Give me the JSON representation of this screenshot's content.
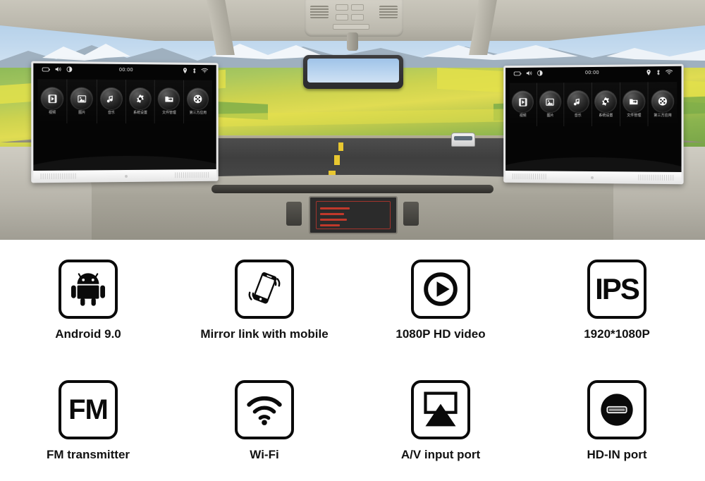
{
  "scene": {
    "name": "car-interior-with-headrest-monitors",
    "description": "Rear view of car cabin driving on a mountain road with two Android headrest monitors mounted on the front seat headrests"
  },
  "monitors": [
    {
      "id": "left",
      "status_bar": {
        "clock": "00:00",
        "left_icons": [
          "battery-icon",
          "volume-icon",
          "brightness-icon"
        ],
        "right_icons": [
          "location-icon",
          "bluetooth-icon",
          "wifi-icon"
        ]
      },
      "apps": [
        {
          "icon": "video-icon",
          "label": "视频"
        },
        {
          "icon": "photo-icon",
          "label": "图片"
        },
        {
          "icon": "music-icon",
          "label": "音乐"
        },
        {
          "icon": "settings-icon",
          "label": "系统设置"
        },
        {
          "icon": "folder-icon",
          "label": "文件管理"
        },
        {
          "icon": "apps-icon",
          "label": "第三方应用"
        }
      ]
    },
    {
      "id": "right",
      "status_bar": {
        "clock": "00:00",
        "left_icons": [
          "battery-icon",
          "volume-icon",
          "brightness-icon"
        ],
        "right_icons": [
          "location-icon",
          "bluetooth-icon",
          "wifi-icon"
        ]
      },
      "apps": [
        {
          "icon": "video-icon",
          "label": "视频"
        },
        {
          "icon": "photo-icon",
          "label": "图片"
        },
        {
          "icon": "music-icon",
          "label": "音乐"
        },
        {
          "icon": "settings-icon",
          "label": "系统设置"
        },
        {
          "icon": "folder-icon",
          "label": "文件管理"
        },
        {
          "icon": "apps-icon",
          "label": "第三方应用"
        }
      ]
    }
  ],
  "features": [
    {
      "icon": "android-robot-icon",
      "label": "Android 9.0",
      "boxed_text": ""
    },
    {
      "icon": "mirror-link-icon",
      "label": "Mirror link with mobile",
      "boxed_text": ""
    },
    {
      "icon": "play-circle-icon",
      "label": "1080P HD video",
      "boxed_text": ""
    },
    {
      "icon": "ips-text-icon",
      "label": "1920*1080P",
      "boxed_text": "IPS"
    },
    {
      "icon": "fm-text-icon",
      "label": "FM transmitter",
      "boxed_text": "FM"
    },
    {
      "icon": "wifi-icon",
      "label": "Wi-Fi",
      "boxed_text": ""
    },
    {
      "icon": "av-input-icon",
      "label": "A/V input port",
      "boxed_text": ""
    },
    {
      "icon": "hd-in-port-icon",
      "label": "HD-IN port",
      "boxed_text": ""
    }
  ],
  "colors": {
    "icon_outline": "#0a0a0a",
    "background": "#ffffff",
    "screen": "#050505",
    "bezel": "#e9e9e9"
  }
}
